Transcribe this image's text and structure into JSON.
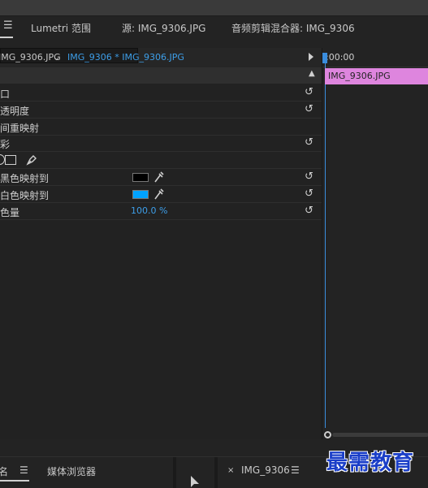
{
  "top_tabs": {
    "lumetri_scopes": "Lumetri 范围",
    "source": "源: IMG_9306.JPG",
    "audio_mixer": "音频剪辑混合器: IMG_9306"
  },
  "effect_controls": {
    "subtab_master": "IMG_9306.JPG",
    "subtab_clip": "IMG_9306 * IMG_9306.JPG",
    "section_label": "",
    "rows": {
      "row1_label": "口",
      "row2_label": "透明度",
      "row3_label": "间重映射",
      "row4_label": "彩",
      "black_map_label": "将黑色映射到",
      "white_map_label": "将白色映射到",
      "tint_amount_label": "着色量",
      "tint_amount_value": "100.0 %"
    },
    "colors": {
      "black_swatch": "#000000",
      "white_swatch": "#00a2ff"
    }
  },
  "timeline": {
    "timecode": ":00:00",
    "clip_name": "IMG_9306.JPG",
    "clip_color": "#de85de"
  },
  "bottom_tabs": {
    "name_tab": "名",
    "media_browser": "媒体浏览器",
    "sequence_tab": "IMG_9306"
  },
  "watermark_text": "最需教育"
}
